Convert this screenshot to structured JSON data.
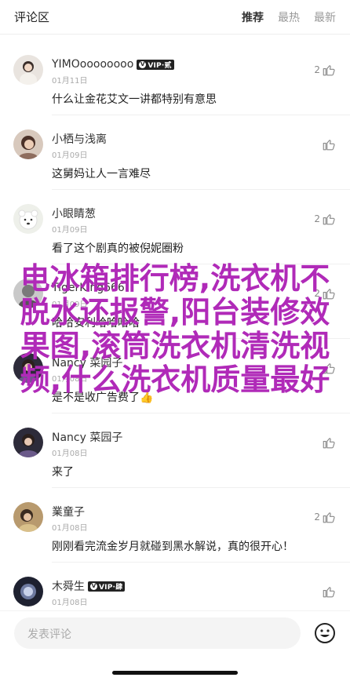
{
  "header": {
    "title": "评论区",
    "tabs": [
      "推荐",
      "最热",
      "最新"
    ]
  },
  "comments": [
    {
      "name": "YIMOoooooooo",
      "vip": "VIP·贰",
      "date": "01月11日",
      "text": "什么让金花艾文一讲都特别有意思",
      "likes": "2"
    },
    {
      "name": "小栖与浅离",
      "vip": "",
      "date": "01月09日",
      "text": "这舅妈让人一言难尽",
      "likes": ""
    },
    {
      "name": "小眼睛葱",
      "vip": "",
      "date": "01月09日",
      "text": "看了这个剧真的被倪妮圈粉",
      "likes": "2"
    },
    {
      "name": "TigerKing666",
      "vip": "",
      "date": "01月09日",
      "text": "哈哈安利哈哈哈哈",
      "likes": "2"
    },
    {
      "name": "Nancy 菜园子",
      "vip": "",
      "date": "01月08日",
      "text": "是不是收广告费了👍",
      "likes": ""
    },
    {
      "name": "Nancy 菜园子",
      "vip": "",
      "date": "01月08日",
      "text": "来了",
      "likes": ""
    },
    {
      "name": "業童子",
      "vip": "",
      "date": "01月08日",
      "text": "刚刚看完流金岁月就碰到黑水解说，真的很开心！",
      "likes": "2"
    },
    {
      "name": "木舜生",
      "vip": "VIP·肆",
      "date": "01月08日",
      "text": "",
      "likes": ""
    }
  ],
  "overlay_text": "电冰箱排行榜,洗衣机不脱水还报警,阳台装修效果图,滚筒洗衣机清洗视频,什么洗衣机质量最好",
  "input": {
    "placeholder": "发表评论"
  },
  "colors": {
    "overlay": "#b02ab8",
    "vip_badge": "#222222"
  }
}
